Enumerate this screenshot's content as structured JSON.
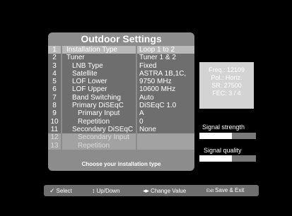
{
  "panel": {
    "title": "Outdoor Settings",
    "hint": "Choose your installation type",
    "rows": [
      {
        "num": "1",
        "label": "Installation Type",
        "value": "Loop 1 to 2",
        "indent": 0,
        "state": "sel"
      },
      {
        "num": "2",
        "label": "Tuner",
        "value": "Tuner 1 & 2",
        "indent": 0,
        "state": ""
      },
      {
        "num": "3",
        "label": "LNB Type",
        "value": "Fixed",
        "indent": 1,
        "state": ""
      },
      {
        "num": "4",
        "label": "Satellite",
        "value": "ASTRA 1B,1C,",
        "indent": 1,
        "state": ""
      },
      {
        "num": "5",
        "label": "LOF Lower",
        "value": "9750 MHz",
        "indent": 1,
        "state": ""
      },
      {
        "num": "6",
        "label": "LOF Upper",
        "value": "10600 MHz",
        "indent": 1,
        "state": ""
      },
      {
        "num": "7",
        "label": "Band Switching",
        "value": "Auto",
        "indent": 1,
        "state": ""
      },
      {
        "num": "8",
        "label": "Primary DiSEqC",
        "value": "DiSEqC 1.0",
        "indent": 1,
        "state": ""
      },
      {
        "num": "9",
        "label": "Primary Input",
        "value": "A",
        "indent": 2,
        "state": ""
      },
      {
        "num": "10",
        "label": "Repetition",
        "value": "0",
        "indent": 2,
        "state": ""
      },
      {
        "num": "11",
        "label": "Secondary DiSEqC",
        "value": "None",
        "indent": 1,
        "state": ""
      },
      {
        "num": "12",
        "label": "Secondary Input",
        "value": "",
        "indent": 2,
        "state": "dim"
      },
      {
        "num": "13",
        "label": "Repetition",
        "value": "",
        "indent": 2,
        "state": "dim"
      }
    ]
  },
  "info": {
    "freq": "Freq.: 12109",
    "pol": "Pol.: Horiz.",
    "sr": "SR: 27500",
    "fec": "FEC: 3 / 4"
  },
  "signal": {
    "strength_label": "Signal strength",
    "strength_level": 0.58,
    "quality_label": "Signal quality",
    "quality_level": 0.58
  },
  "bottom_bar": {
    "select_icon": "check-icon",
    "select_label": "Select",
    "updown_icon": "updown-arrow-icon",
    "updown_label": "Up/Down",
    "change_icon": "leftright-arrow-icon",
    "change_label": "Change Value",
    "exit_icon": "exit-key-icon",
    "exit_label": "Save & Exit"
  }
}
